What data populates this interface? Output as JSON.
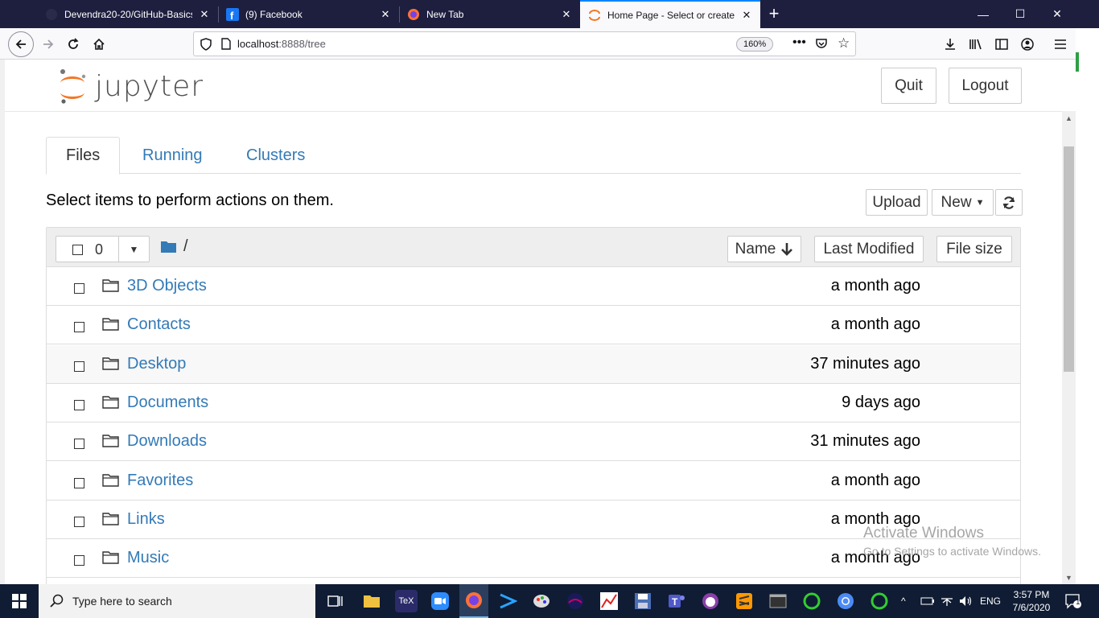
{
  "browser": {
    "tabs": [
      {
        "title": "Devendra20-20/GitHub-Basics"
      },
      {
        "title": "(9) Facebook"
      },
      {
        "title": "New Tab"
      },
      {
        "title": "Home Page - Select or create a"
      }
    ],
    "url_host": "localhost",
    "url_path": ":8888/tree",
    "zoom": "160%"
  },
  "jupyter": {
    "logo_text": "jupyter",
    "quit_label": "Quit",
    "logout_label": "Logout",
    "tabs": [
      {
        "label": "Files"
      },
      {
        "label": "Running"
      },
      {
        "label": "Clusters"
      }
    ],
    "hint": "Select items to perform actions on them.",
    "upload_label": "Upload",
    "new_label": "New",
    "selected_count": "0",
    "breadcrumb": "/",
    "col_name": "Name",
    "col_modified": "Last Modified",
    "col_size": "File size",
    "rows": [
      {
        "name": "3D Objects",
        "modified": "a month ago"
      },
      {
        "name": "Contacts",
        "modified": "a month ago"
      },
      {
        "name": "Desktop",
        "modified": "37 minutes ago"
      },
      {
        "name": "Documents",
        "modified": "9 days ago"
      },
      {
        "name": "Downloads",
        "modified": "31 minutes ago"
      },
      {
        "name": "Favorites",
        "modified": "a month ago"
      },
      {
        "name": "Links",
        "modified": "a month ago"
      },
      {
        "name": "Music",
        "modified": "a month ago"
      }
    ]
  },
  "watermark": {
    "line1": "Activate Windows",
    "line2": "Go to Settings to activate Windows."
  },
  "taskbar": {
    "search_placeholder": "Type here to search",
    "language": "ENG",
    "time": "3:57 PM",
    "date": "7/6/2020",
    "notification_count": "1"
  },
  "colors": {
    "link": "#337ab7",
    "jupyter_orange": "#f37726",
    "tabstrip": "#1e1e3f",
    "taskbar": "#0f1c33"
  }
}
